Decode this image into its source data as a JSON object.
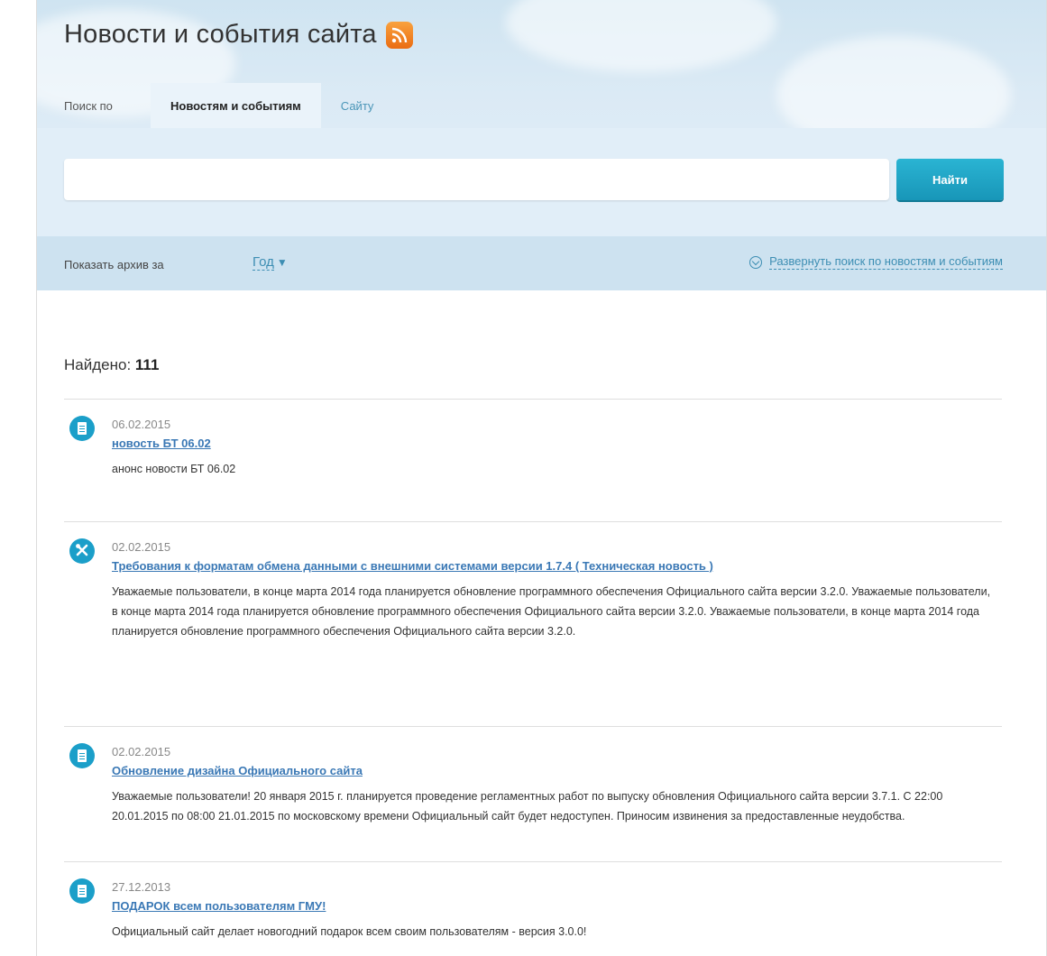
{
  "header": {
    "title": "Новости и события сайта",
    "rss_icon": "rss-icon",
    "rss_color": "#f08a24"
  },
  "tabs": {
    "prefix": "Поиск по",
    "items": [
      {
        "label": "Новостям и событиям",
        "active": true
      },
      {
        "label": "Сайту",
        "active": false
      }
    ]
  },
  "search": {
    "value": "",
    "placeholder": "",
    "button_label": "Найти",
    "button_color": "#1fa6c6"
  },
  "filter": {
    "archive_label": "Показать архив за",
    "period": "Год",
    "period_arrow": "▼",
    "expand_label": "Развернуть поиск по новостям и событиям"
  },
  "results": {
    "found_label": "Найдено:",
    "count": "111"
  },
  "news": [
    {
      "icon": "document-icon",
      "date": "06.02.2015",
      "title": "новость БТ 06.02",
      "text": "анонс новости БТ 06.02"
    },
    {
      "icon": "tools-icon",
      "date": "02.02.2015",
      "title": "Требования к форматам обмена данными с внешними системами версии 1.7.4 ( Техническая новость )",
      "text": "Уважаемые пользователи, в конце марта 2014 года планируется обновление программного обеспечения Официального сайта версии 3.2.0. Уважаемые пользователи, в конце марта 2014 года планируется обновление программного обеспечения Официального сайта версии 3.2.0. Уважаемые пользователи, в конце марта 2014 года планируется обновление программного обеспечения Официального сайта версии 3.2.0."
    },
    {
      "icon": "document-icon",
      "date": "02.02.2015",
      "title": "Обновление дизайна Официального сайта",
      "text": "Уважаемые пользователи! 20 января 2015 г. планируется проведение регламентных работ по выпуску обновления Официального сайта версии 3.7.1. С 22:00 20.01.2015 по 08:00 21.01.2015 по московскому времени Официальный сайт будет недоступен. Приносим извинения за предоставленные неудобства."
    },
    {
      "icon": "document-icon",
      "date": "27.12.2013",
      "title": "ПОДАРОК всем пользователям ГМУ!",
      "text": "Официальный сайт делает новогодний подарок всем своим пользователям - версия 3.0.0!"
    }
  ]
}
